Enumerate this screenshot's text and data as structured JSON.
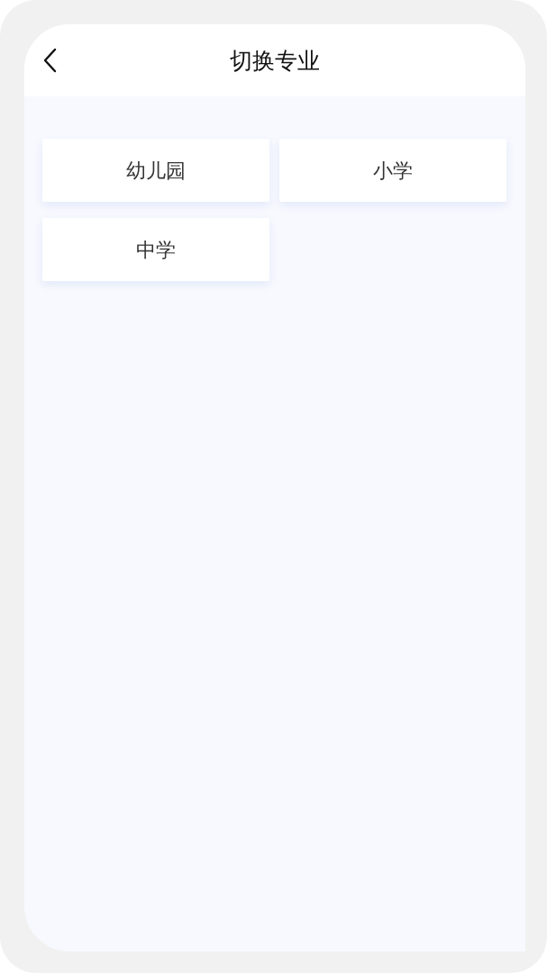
{
  "header": {
    "title": "切换专业"
  },
  "options": [
    {
      "label": "幼儿园"
    },
    {
      "label": "小学"
    },
    {
      "label": "中学"
    }
  ]
}
